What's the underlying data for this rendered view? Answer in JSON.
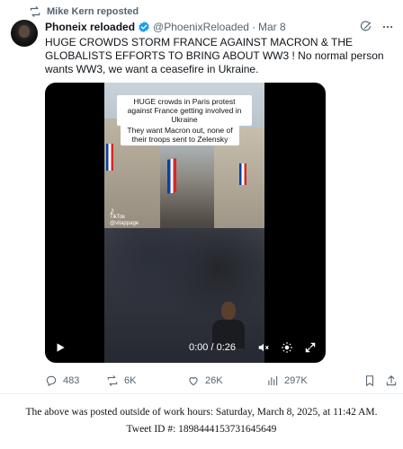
{
  "repost": {
    "label": "Mike Kern reposted",
    "icon": "repost-icon"
  },
  "tweet": {
    "display_name": "Phoneix reloaded",
    "handle": "@PhoenixReloaded",
    "separator": "·",
    "date": "Mar 8",
    "text": "HUGE CROWDS STORM FRANCE AGAINST MACRON & THE GLOBALISTS EFFORTS TO BRING ABOUT WW3 ! No normal person wants WW3, we want a ceasefire in Ukraine.",
    "verified_color": "#1d9bf0"
  },
  "video": {
    "caption_1": "HUGE crowds in Paris protest against France getting involved in Ukraine",
    "caption_2": "They want Macron out, none of their troops sent to Zelensky",
    "watermark_brand": "TikTok",
    "watermark_handle": "@vitappage",
    "time": "0:00 / 0:26"
  },
  "metrics": {
    "replies": "483",
    "reposts": "6K",
    "likes": "26K",
    "views": "297K"
  },
  "footer": {
    "line1": "The above was posted outside of work hours: Saturday, March 8, 2025, at 11:42 AM.",
    "line2": "Tweet ID #: 1898444153731645649"
  }
}
